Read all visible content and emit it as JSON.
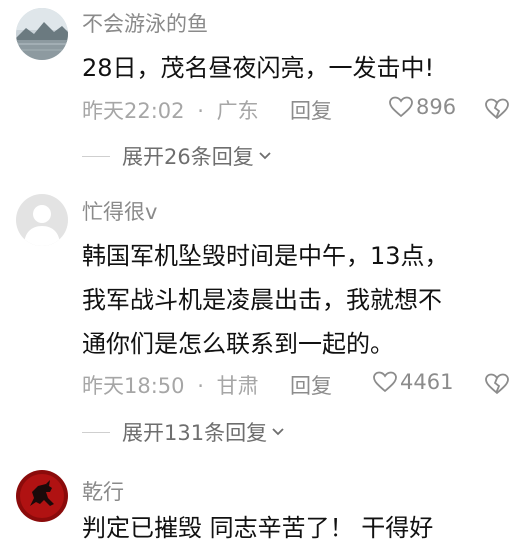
{
  "comments": [
    {
      "username": "不会游泳的鱼",
      "lines": [
        "28日，茂名昼夜闪亮，一发击中!"
      ],
      "time": "昨天22:02",
      "separator": "·",
      "location": "广东",
      "reply_label": "回复",
      "likes": "896",
      "expand_label": "展开26条回复",
      "avatar_icon": "landscape-avatar-icon"
    },
    {
      "username": "忙得很v",
      "lines": [
        "韩国军机坠毁时间是中午，13点，",
        "我军战斗机是凌晨出击，我就想不",
        "通你们是怎么联系到一起的。"
      ],
      "time": "昨天18:50",
      "separator": "·",
      "location": "甘肃",
      "reply_label": "回复",
      "likes": "4461",
      "expand_label": "展开131条回复",
      "avatar_icon": "default-user-avatar-icon"
    },
    {
      "username": "乾行",
      "lines": [
        "判定已摧毁 同志辛苦了！ 干得好"
      ],
      "avatar_icon": "red-horse-avatar-icon"
    }
  ],
  "colors": {
    "username": "#8a8a8a",
    "content": "#111111",
    "meta": "#a6a6a6",
    "expand": "#6e6e6e"
  }
}
